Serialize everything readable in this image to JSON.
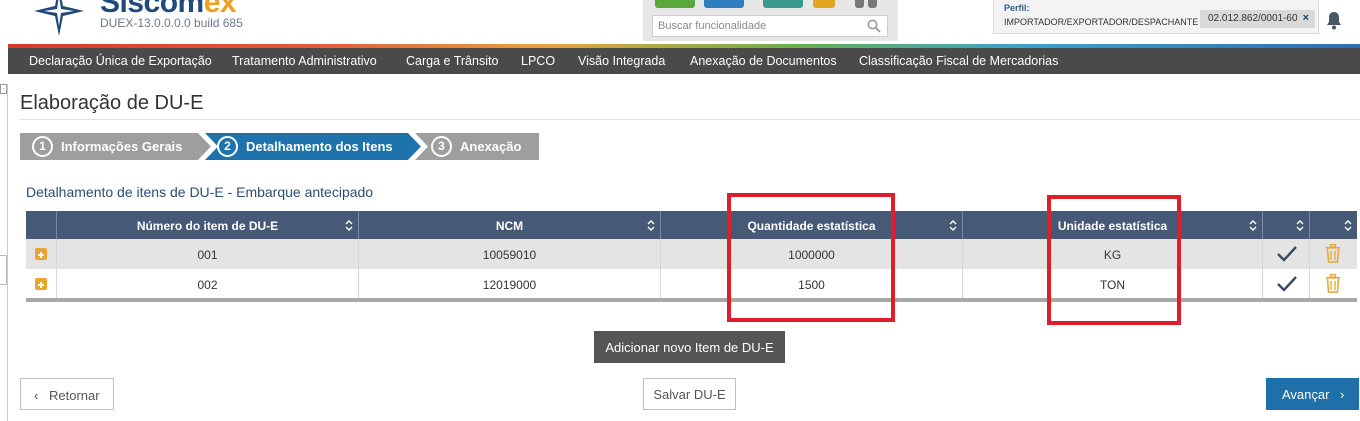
{
  "header": {
    "logo_main": "Siscom",
    "logo_accent": "ex",
    "build": "DUEX-13.0.0.0.0 build 685",
    "search_placeholder": "Buscar funcionalidade",
    "profile_label": "Perfil:",
    "profile_role": "IMPORTADOR/EXPORTADOR/DESPACHANTE",
    "cnpj": "02.012.862/0001-60",
    "cnpj_close": "×",
    "tile_colors": [
      "#5aa83c",
      "#2f7fc0",
      "#3a9a8f",
      "#e4a521"
    ]
  },
  "nav": {
    "items": [
      "Declaração Única de Exportação",
      "Tratamento Administrativo",
      "Carga e Trânsito",
      "LPCO",
      "Visão Integrada",
      "Anexação de Documentos",
      "Classificação Fiscal de Mercadorias"
    ]
  },
  "page": {
    "title": "Elaboração de DU-E",
    "section_title": "Detalhamento de itens de DU-E - Embarque antecipado"
  },
  "wizard": {
    "steps": [
      {
        "num": "1",
        "label": "Informações Gerais",
        "state": "done"
      },
      {
        "num": "2",
        "label": "Detalhamento dos Itens",
        "state": "active"
      },
      {
        "num": "3",
        "label": "Anexação",
        "state": "pending"
      }
    ]
  },
  "table": {
    "columns": [
      "Número do item de DU-E",
      "NCM",
      "Quantidade estatística",
      "Unidade estatística"
    ],
    "rows": [
      {
        "item": "001",
        "ncm": "10059010",
        "quantidade": "1000000",
        "unidade": "KG"
      },
      {
        "item": "002",
        "ncm": "12019000",
        "quantidade": "1500",
        "unidade": "TON"
      }
    ]
  },
  "buttons": {
    "add_item": "Adicionar novo Item de DU-E",
    "back": "Retornar",
    "save": "Salvar DU-E",
    "next": "Avançar",
    "back_chevron": "‹",
    "next_chevron": "›"
  },
  "colors": {
    "nav_bg": "#4a4a4a",
    "table_header": "#465a78",
    "step_done": "#9e9e9e",
    "step_active": "#1f73ad",
    "highlight": "#e01d2b",
    "primary_button": "#1f6fa8"
  }
}
